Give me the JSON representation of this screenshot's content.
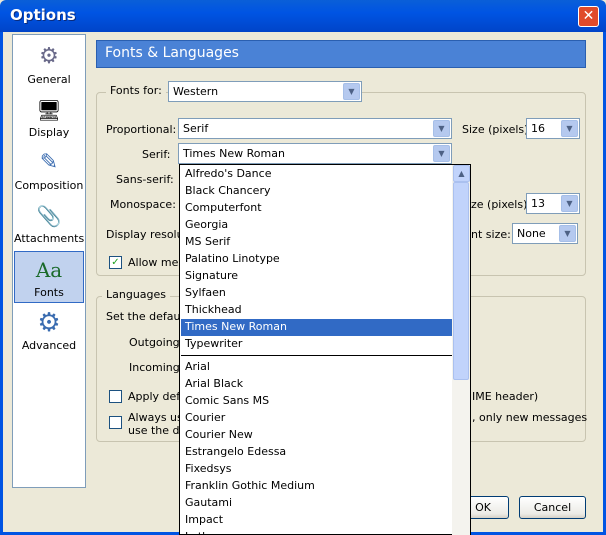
{
  "window": {
    "title": "Options",
    "close_glyph": "✕"
  },
  "sidebar": {
    "items": [
      {
        "label": "General",
        "icon": "general-icon",
        "glyph": "⚙"
      },
      {
        "label": "Display",
        "icon": "display-icon",
        "glyph": "🖥"
      },
      {
        "label": "Composition",
        "icon": "composition-icon",
        "glyph": "✎"
      },
      {
        "label": "Attachments",
        "icon": "paperclip-icon",
        "glyph": "📎"
      },
      {
        "label": "Fonts",
        "icon": "fonts-icon",
        "glyph": "Aa",
        "active": true
      },
      {
        "label": "Advanced",
        "icon": "advanced-icon",
        "glyph": "⚙"
      }
    ]
  },
  "panel": {
    "header": "Fonts & Languages",
    "fonts_for_label": "Fonts for:",
    "fonts_for_value": "Western",
    "proportional_label": "Proportional:",
    "proportional_value": "Serif",
    "size_pixels_label": "Size (pixels)",
    "proportional_size": "16",
    "serif_label": "Serif:",
    "serif_value": "Times New Roman",
    "sans_serif_label": "Sans-serif:",
    "monospace_label": "Monospace:",
    "size_pixels_label_partial": "ze (pixels)",
    "monospace_size": "13",
    "display_resolution_label": "Display resolu",
    "min_font_size_label_partial": "nt size:",
    "min_font_size_value": "None",
    "allow_messages_label": "Allow mess",
    "allow_messages_checked": true,
    "languages_group_label": "Languages",
    "set_default_label": "Set the defaul",
    "outgoing_label": "Outgoing",
    "incoming_label": "Incoming",
    "apply_default_label": "Apply defa",
    "ime_header_label": "IME header)",
    "always_use_label_1": "Always us",
    "always_use_label_2": "use the de",
    "only_new_messages_label": ", only new messages"
  },
  "buttons": {
    "ok_label": "OK",
    "cancel_label": "Cancel"
  },
  "dropdown": {
    "arrow_glyph": "▼",
    "up_glyph": "▲",
    "group1": [
      "Alfredo's Dance",
      "Black Chancery",
      "Computerfont",
      "Georgia",
      "MS Serif",
      "Palatino Linotype",
      "Signature",
      "Sylfaen",
      "Thickhead",
      "Times New Roman",
      "Typewriter"
    ],
    "selected_index": 9,
    "group2": [
      "Arial",
      "Arial Black",
      "Comic Sans MS",
      "Courier",
      "Courier New",
      "Estrangelo Edessa",
      "Fixedsys",
      "Franklin Gothic Medium",
      "Gautami",
      "Impact",
      "Latha"
    ]
  },
  "colors": {
    "titlebar": "#0054e3",
    "header": "#4a82d6",
    "selection": "#316ac5"
  }
}
